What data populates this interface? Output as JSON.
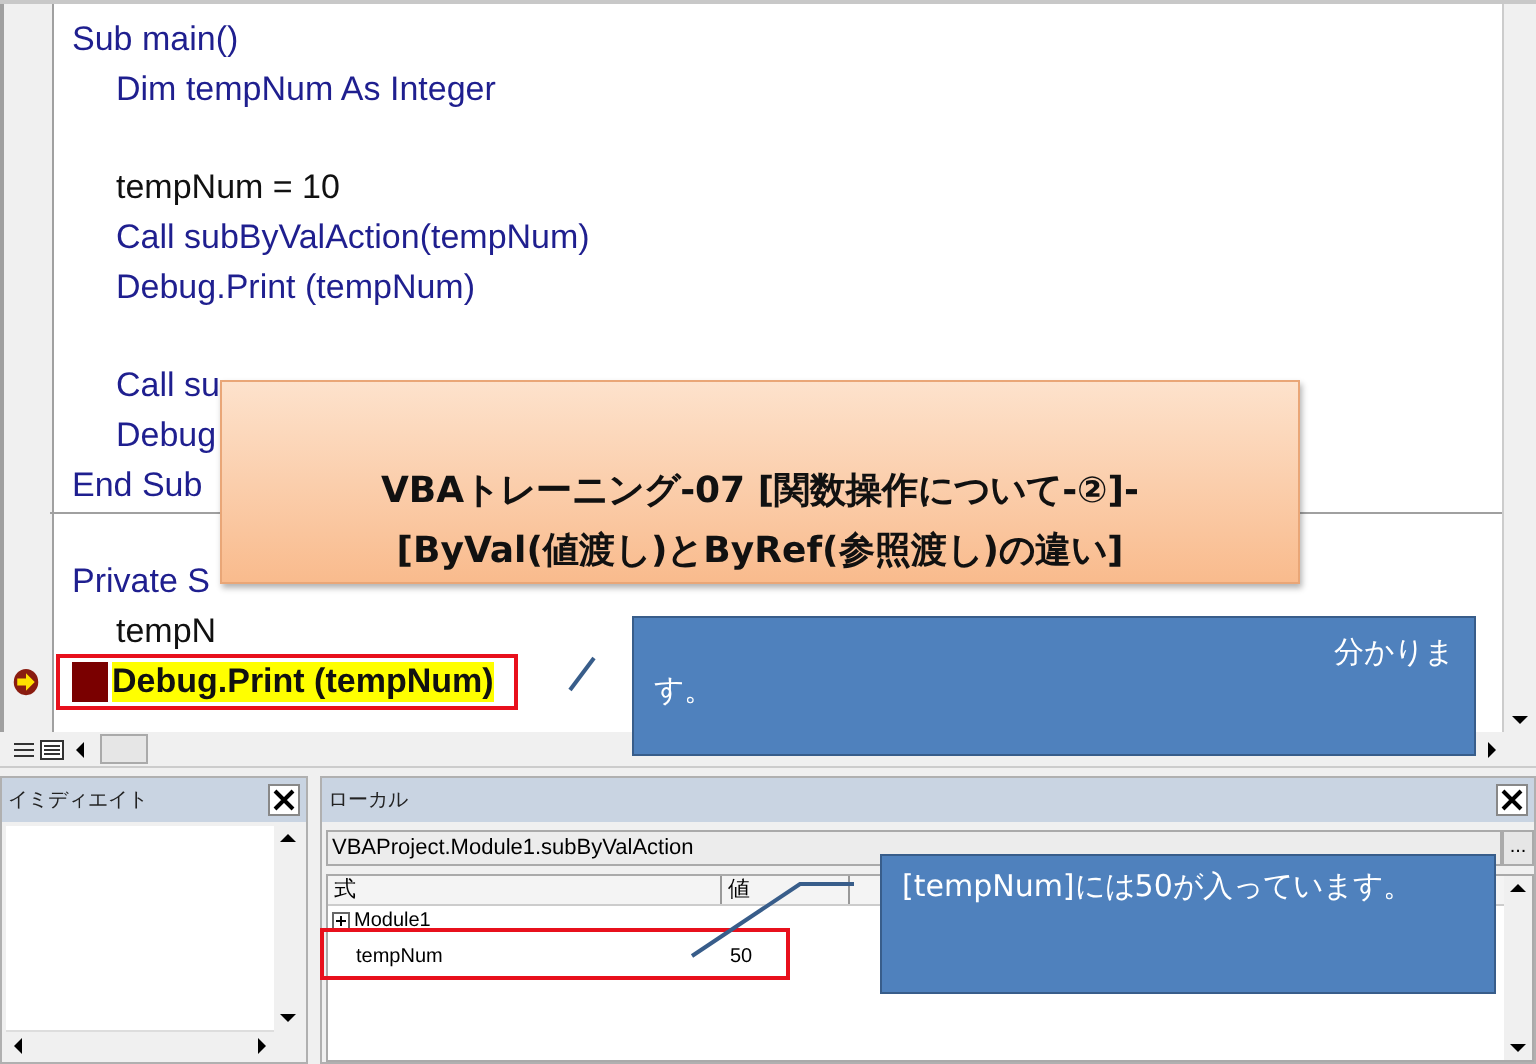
{
  "code_editor": {
    "procedures": [
      {
        "header": "Sub main()",
        "footer": "End Sub",
        "children": [
          {
            "kind": "keyword",
            "text": "Dim tempNum As Integer",
            "current": false
          },
          {
            "kind": "blank"
          },
          {
            "kind": "plain",
            "text": "tempNum = 10",
            "current": false
          },
          {
            "kind": "keyword",
            "text": "Call subByValAction(tempNum)",
            "current": false
          },
          {
            "kind": "keyword",
            "text": "Debug.Print (tempNum)",
            "current": false
          },
          {
            "kind": "blank"
          },
          {
            "kind": "keyword",
            "text": "Call su",
            "current": false
          },
          {
            "kind": "keyword",
            "text": "Debug",
            "current": false
          }
        ]
      },
      {
        "header": "Private S",
        "children": [
          {
            "kind": "plain",
            "text": "tempN",
            "current": false
          },
          {
            "kind": "plain",
            "text": "Debug.Print (tempNum)",
            "current": true
          }
        ]
      }
    ]
  },
  "banner": {
    "lines": [
      "VBAトレーニング-07  [関数操作について-②]-",
      "[ByVal(値渡し)とByRef(参照渡し)の違い]"
    ]
  },
  "code_callout": {
    "lines": [
      "分かりま",
      "す。"
    ]
  },
  "immediate_window": {
    "title": "イミディエイト"
  },
  "locals_window": {
    "title": "ローカル",
    "context": "VBAProject.Module1.subByValAction",
    "context_button": "...",
    "columns": [
      "式",
      "値"
    ],
    "rows": [
      {
        "name": "Module1",
        "expandable": true
      },
      {
        "name": "tempNum",
        "value": "50",
        "expandable": false
      }
    ]
  },
  "locals_callout": {
    "text": "[tempNum]には50が入っています。"
  }
}
